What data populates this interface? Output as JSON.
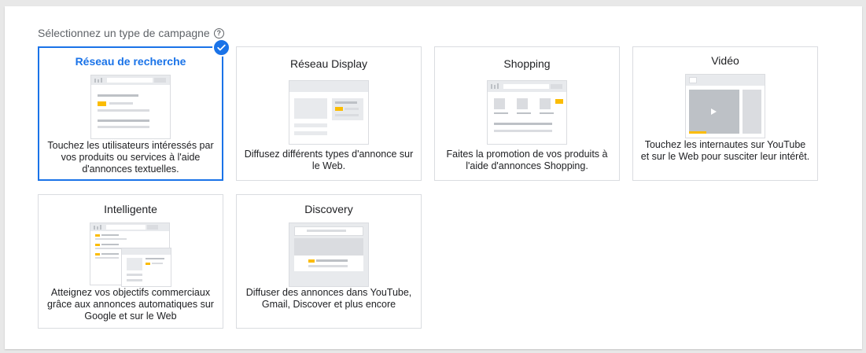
{
  "header": {
    "title": "Sélectionnez un type de campagne",
    "help_icon": "help-circle-icon"
  },
  "colors": {
    "accent": "#1a73e8",
    "ad_yellow": "#fbbc04"
  },
  "campaign_types": [
    {
      "title": "Réseau de recherche",
      "description": "Touchez les utilisateurs intéressés par vos produits ou services à l'aide d'annonces textuelles.",
      "selected": true
    },
    {
      "title": "Réseau Display",
      "description": "Diffusez différents types d'annonce sur le Web.",
      "selected": false
    },
    {
      "title": "Shopping",
      "description": "Faites la promotion de vos produits à l'aide d'annonces Shopping.",
      "selected": false
    },
    {
      "title": "Vidéo",
      "description": "Touchez les internautes sur YouTube et sur le Web pour susciter leur intérêt.",
      "selected": false
    },
    {
      "title": "Intelligente",
      "description": "Atteignez vos objectifs commerciaux grâce aux annonces automatiques sur Google et sur le Web",
      "selected": false
    },
    {
      "title": "Discovery",
      "description": "Diffuser des annonces dans YouTube, Gmail, Discover et plus encore",
      "selected": false
    }
  ]
}
